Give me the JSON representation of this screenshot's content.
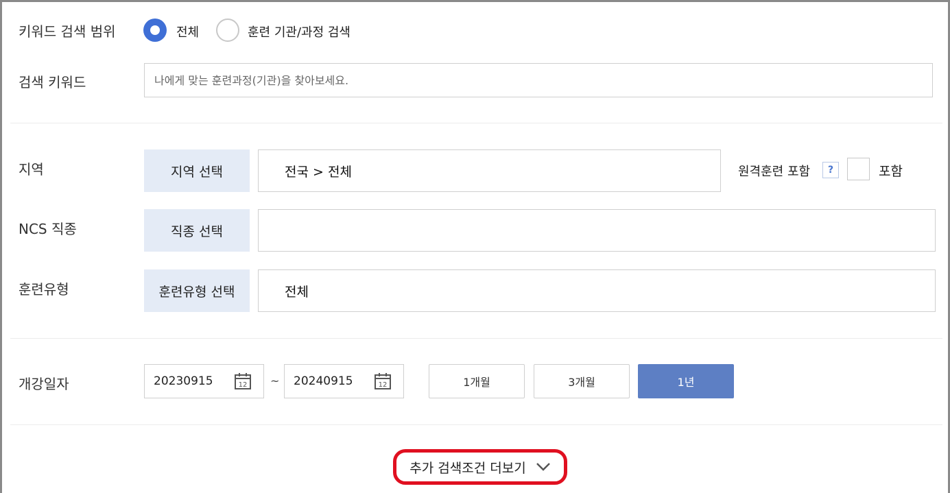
{
  "scope": {
    "label": "키워드 검색 범위",
    "options": [
      {
        "label": "전체",
        "selected": true
      },
      {
        "label": "훈련 기관/과정 검색",
        "selected": false
      }
    ]
  },
  "keyword": {
    "label": "검색 키워드",
    "placeholder": "나에게 맞는 훈련과정(기관)을 찾아보세요.",
    "value": ""
  },
  "region": {
    "label": "지역",
    "button": "지역 선택",
    "value": "전국 > 전체",
    "remote_label": "원격훈련 포함",
    "help": "?",
    "include_label": "포함"
  },
  "ncs": {
    "label": "NCS 직종",
    "button": "직종 선택",
    "value": ""
  },
  "training_type": {
    "label": "훈련유형",
    "button": "훈련유형 선택",
    "value": "전체"
  },
  "dates": {
    "label": "개강일자",
    "start": "20230915",
    "end": "20240915",
    "separator": "~",
    "calendar_day": "12",
    "periods": [
      {
        "label": "1개월",
        "active": false
      },
      {
        "label": "3개월",
        "active": false
      },
      {
        "label": "1년",
        "active": true
      }
    ]
  },
  "more": {
    "label": "추가 검색조건 더보기"
  },
  "colors": {
    "accent": "#3f6fd6",
    "active_button": "#5d7fc4",
    "select_bg": "#e4ebf6",
    "highlight": "#e01020"
  }
}
